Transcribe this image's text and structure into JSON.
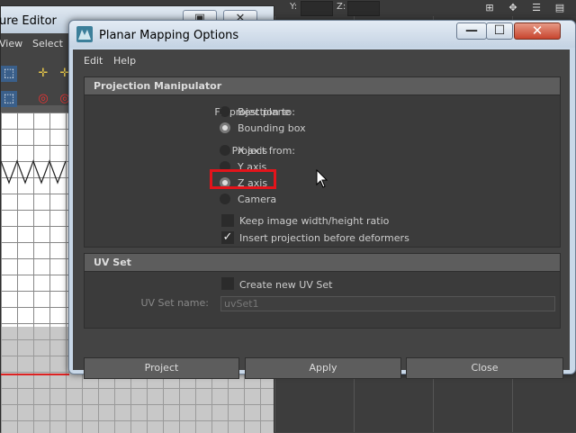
{
  "background": {
    "coord_y": "Y:",
    "coord_z": "Z:",
    "window_title": "ure Editor",
    "menu": [
      "View",
      "Select"
    ],
    "win_restore": "▣",
    "win_close": "✕"
  },
  "dialog": {
    "title": "Planar Mapping Options",
    "controls": {
      "minimize": "—",
      "maximize": "☐",
      "close": "✕"
    },
    "menu": {
      "edit": "Edit",
      "help": "Help"
    },
    "projection": {
      "heading": "Projection Manipulator",
      "fit_label": "Fit projection to:",
      "fit_options": [
        "Best plane",
        "Bounding box"
      ],
      "fit_selected": "Bounding box",
      "project_label": "Project from:",
      "project_options": [
        "X axis",
        "Y axis",
        "Z axis",
        "Camera"
      ],
      "project_selected": "Z axis",
      "keep_ratio_label": "Keep image width/height ratio",
      "keep_ratio_checked": false,
      "insert_label": "Insert projection before deformers",
      "insert_checked": true
    },
    "uvset": {
      "heading": "UV Set",
      "create_label": "Create new UV Set",
      "create_checked": false,
      "name_label": "UV Set name:",
      "name_value": "uvSet1"
    },
    "buttons": {
      "project": "Project",
      "apply": "Apply",
      "close": "Close"
    }
  },
  "colors": {
    "highlight": "#e3141b",
    "panel": "#444444",
    "section_header": "#5d5d5d"
  }
}
